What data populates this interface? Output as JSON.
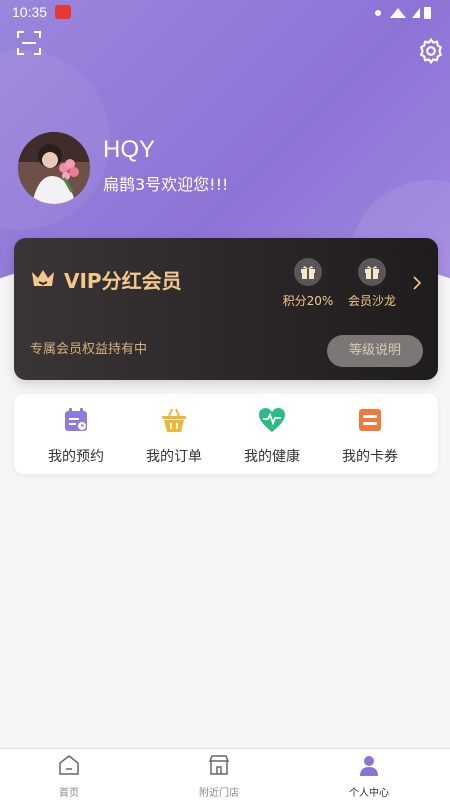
{
  "status_bar": {
    "time": "10:35"
  },
  "user": {
    "name": "HQY",
    "welcome": "扁鹊3号欢迎您!!!"
  },
  "vip": {
    "title": "VIP分红会员",
    "perks": [
      {
        "label": "积分20%",
        "icon": "gift-icon"
      },
      {
        "label": "会员沙龙",
        "icon": "gift-icon"
      }
    ],
    "subtitle": "专属会员权益持有中",
    "level_button": "等级说明"
  },
  "quick_actions": [
    {
      "label": "我的预约",
      "icon": "calendar-icon",
      "color": "#8e7ad8"
    },
    {
      "label": "我的订单",
      "icon": "basket-icon",
      "color": "#f0b533"
    },
    {
      "label": "我的健康",
      "icon": "heart-pulse-icon",
      "color": "#2dbb85"
    },
    {
      "label": "我的卡券",
      "icon": "wallet-icon",
      "color": "#f07a3a"
    }
  ],
  "tabs": [
    {
      "label": "首页",
      "icon": "home-icon"
    },
    {
      "label": "附近门店",
      "icon": "store-icon"
    },
    {
      "label": "个人中心",
      "icon": "user-icon",
      "active": true
    }
  ],
  "colors": {
    "accent": "#8e73d6",
    "gold": "#f3c88a",
    "card_dark": "#2a2627"
  }
}
